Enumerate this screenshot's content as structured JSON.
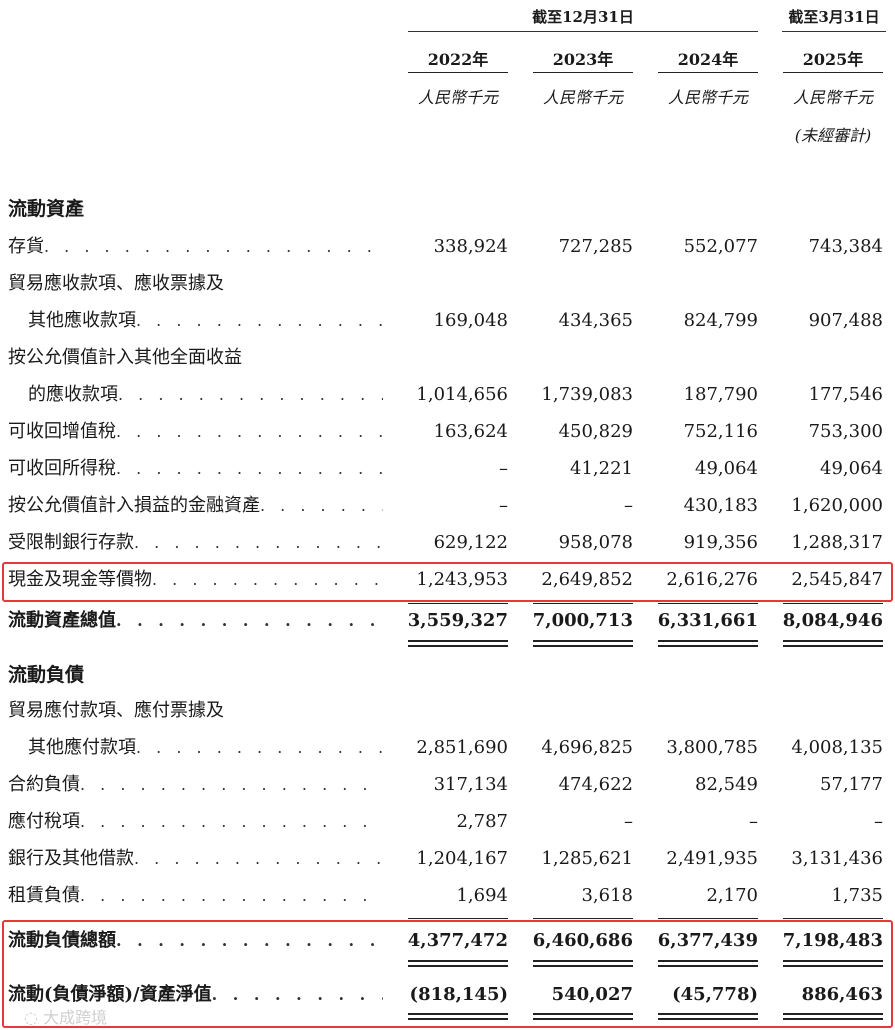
{
  "header": {
    "group1": "截至12月31日",
    "group2": "截至3月31日",
    "years": [
      "2022年",
      "2023年",
      "2024年",
      "2025年"
    ],
    "unit": "人民幣千元",
    "unaudited": "(未經審計)"
  },
  "sections": {
    "current_assets": "流動資產",
    "current_liabilities": "流動負債"
  },
  "rows": [
    {
      "label": "存貨",
      "values": [
        "338,924",
        "727,285",
        "552,077",
        "743,384"
      ]
    },
    {
      "label": "貿易應收款項、應收票據及",
      "values": []
    },
    {
      "label": "其他應收款項",
      "values": [
        "169,048",
        "434,365",
        "824,799",
        "907,488"
      ]
    },
    {
      "label": "按公允價值計入其他全面收益",
      "values": []
    },
    {
      "label": "的應收款項",
      "values": [
        "1,014,656",
        "1,739,083",
        "187,790",
        "177,546"
      ]
    },
    {
      "label": "可收回增值稅",
      "values": [
        "163,624",
        "450,829",
        "752,116",
        "753,300"
      ]
    },
    {
      "label": "可收回所得稅",
      "values": [
        "–",
        "41,221",
        "49,064",
        "49,064"
      ]
    },
    {
      "label": "按公允價值計入損益的金融資產",
      "values": [
        "–",
        "–",
        "430,183",
        "1,620,000"
      ]
    },
    {
      "label": "受限制銀行存款",
      "values": [
        "629,122",
        "958,078",
        "919,356",
        "1,288,317"
      ]
    },
    {
      "label": "現金及現金等價物",
      "values": [
        "1,243,953",
        "2,649,852",
        "2,616,276",
        "2,545,847"
      ]
    },
    {
      "label": "流動資產總值",
      "values": [
        "3,559,327",
        "7,000,713",
        "6,331,661",
        "8,084,946"
      ]
    },
    {
      "label": "貿易應付款項、應付票據及",
      "values": []
    },
    {
      "label": "其他應付款項",
      "values": [
        "2,851,690",
        "4,696,825",
        "3,800,785",
        "4,008,135"
      ]
    },
    {
      "label": "合約負債",
      "values": [
        "317,134",
        "474,622",
        "82,549",
        "57,177"
      ]
    },
    {
      "label": "應付稅項",
      "values": [
        "2,787",
        "–",
        "–",
        "–"
      ]
    },
    {
      "label": "銀行及其他借款",
      "values": [
        "1,204,167",
        "1,285,621",
        "2,491,935",
        "3,131,436"
      ]
    },
    {
      "label": "租賃負債",
      "values": [
        "1,694",
        "3,618",
        "2,170",
        "1,735"
      ]
    },
    {
      "label": "流動負債總額",
      "values": [
        "4,377,472",
        "6,460,686",
        "6,377,439",
        "7,198,483"
      ]
    },
    {
      "label": "流動(負債淨額)/資產淨值",
      "values": [
        "(818,145)",
        "540,027",
        "(45,778)",
        "886,463"
      ]
    }
  ],
  "dots": ". . . . . . . . . . . . . . . . . . . . . . . . . . . . . . . . . . . . .",
  "watermark": "大成跨境",
  "highlight_color": "#e03a3a"
}
